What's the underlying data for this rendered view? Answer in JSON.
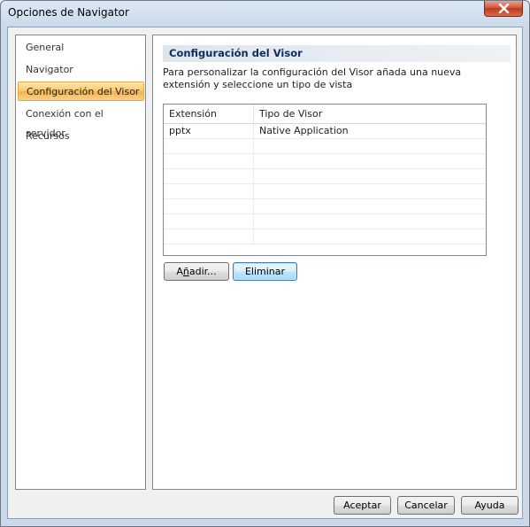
{
  "window": {
    "title": "Opciones de Navigator"
  },
  "sidebar": {
    "items": [
      {
        "label": "General"
      },
      {
        "label": "Navigator"
      },
      {
        "label": "Configuración del Visor",
        "selected": true
      },
      {
        "label": "Conexión con el servidor"
      },
      {
        "label": "Recursos"
      }
    ]
  },
  "content": {
    "section_title": "Configuración del Visor",
    "description": "Para personalizar la configuración del Visor añada una nueva extensión y seleccione un tipo de vista",
    "table": {
      "columns": [
        "Extensión",
        "Tipo de Visor"
      ],
      "rows": [
        [
          "pptx",
          "Native Application"
        ],
        [
          "",
          ""
        ],
        [
          "",
          ""
        ],
        [
          "",
          ""
        ],
        [
          "",
          ""
        ],
        [
          "",
          ""
        ],
        [
          "",
          ""
        ],
        [
          "",
          ""
        ]
      ]
    },
    "add_button": {
      "label_prefix": "A",
      "label_mnemonic": "ñ",
      "label_suffix": "adir..."
    },
    "remove_button": {
      "label": "Eliminar"
    }
  },
  "footer": {
    "ok_label": "Aceptar",
    "cancel_label": "Cancelar",
    "help_label": "Ayuda"
  },
  "colors": {
    "selection": "#f9c76a",
    "header_text": "#0f2d5a",
    "close_button": "#c0391a"
  }
}
